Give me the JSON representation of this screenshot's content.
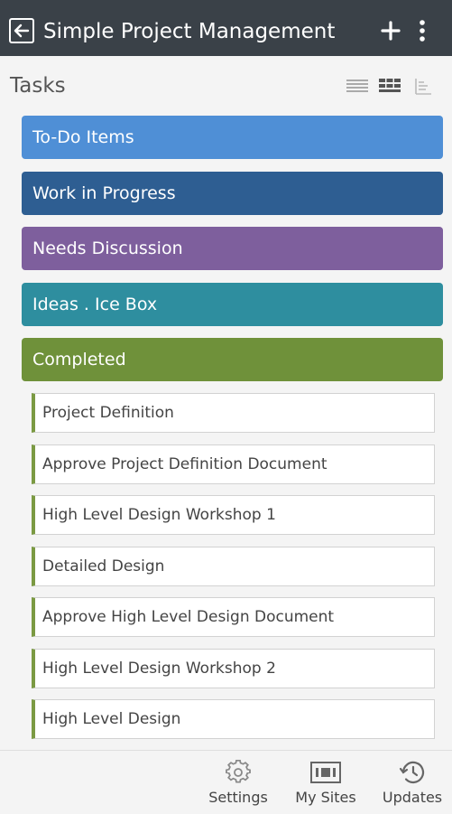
{
  "app_bar": {
    "title": "Simple Project Management",
    "back_icon": "arrow-left-icon",
    "add_icon": "plus-icon",
    "more_icon": "more-vertical-icon"
  },
  "section": {
    "title": "Tasks",
    "view_icons": [
      "list-view-icon",
      "board-view-icon",
      "tree-view-icon"
    ]
  },
  "lanes": [
    {
      "label": "To-Do Items",
      "color": "#4f8fd6"
    },
    {
      "label": "Work in Progress",
      "color": "#2e5e92"
    },
    {
      "label": "Needs Discussion",
      "color": "#7e5f9d"
    },
    {
      "label": "Ideas . Ice Box",
      "color": "#2e8e9f"
    },
    {
      "label": "Completed",
      "color": "#6f913a"
    }
  ],
  "completed_tasks": [
    "Project Definition",
    "Approve Project Definition Document",
    "High Level Design Workshop 1",
    "Detailed Design",
    "Approve High Level Design Document",
    "High Level Design Workshop 2",
    "High Level Design"
  ],
  "bottom_nav": [
    {
      "label": "Settings",
      "icon": "gear-icon"
    },
    {
      "label": "My Sites",
      "icon": "sites-icon"
    },
    {
      "label": "Updates",
      "icon": "history-icon"
    }
  ]
}
